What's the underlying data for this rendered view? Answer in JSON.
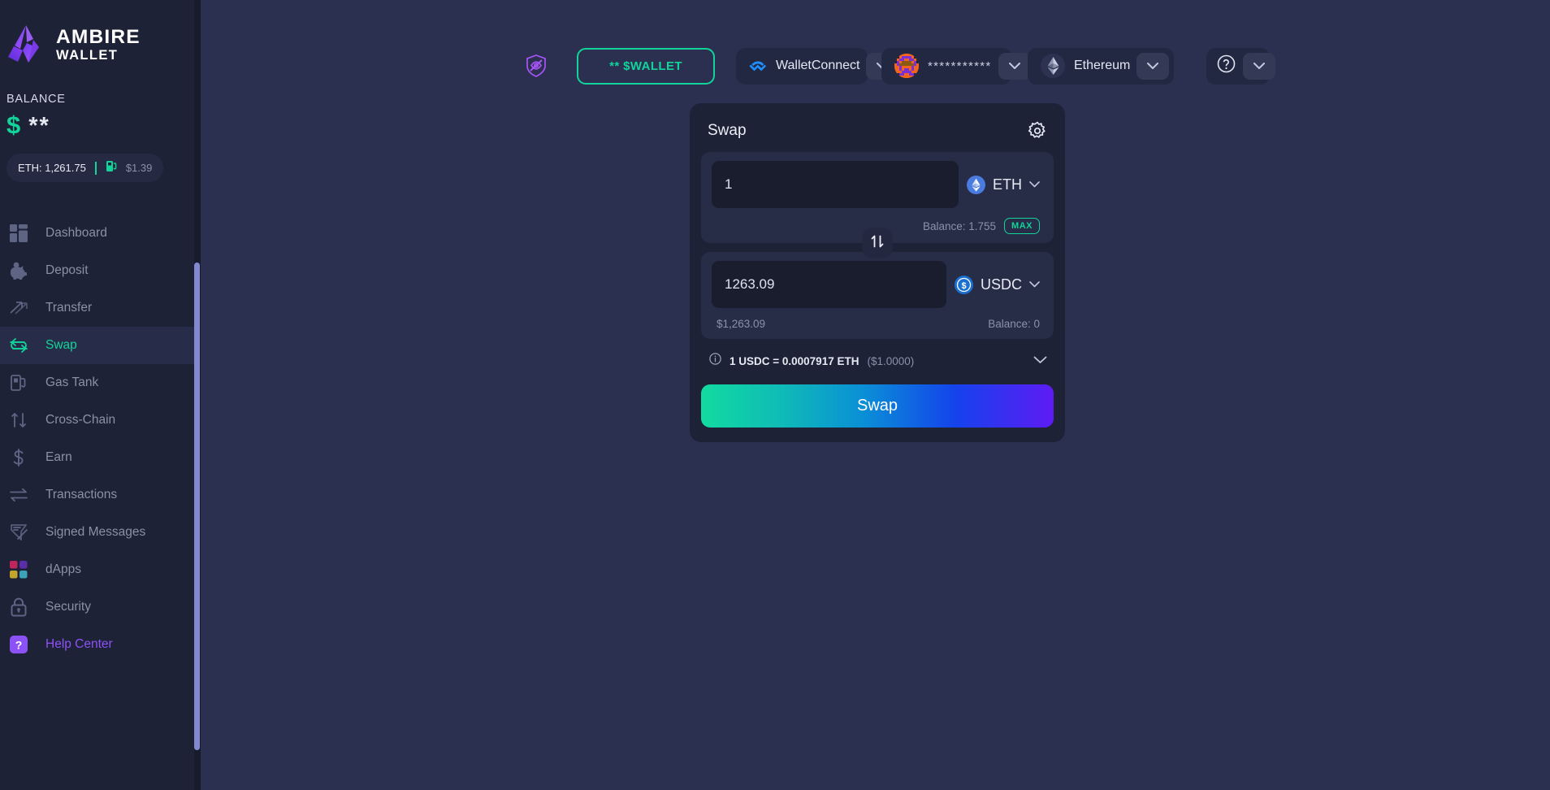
{
  "brand": {
    "name": "AMBIRE",
    "sub": "WALLET",
    "logo_icon": "ambire-logo-icon"
  },
  "sidebar": {
    "balance_label": "BALANCE",
    "balance_currency": "$",
    "balance_value": "**",
    "gas_chip": {
      "eth_label": "ETH: 1,261.75",
      "gas_icon": "gas-pump-icon",
      "gas_price": "$1.39"
    },
    "items": [
      {
        "label": "Dashboard",
        "icon": "dashboard-grid-icon",
        "active": false
      },
      {
        "label": "Deposit",
        "icon": "piggy-bank-icon",
        "active": false
      },
      {
        "label": "Transfer",
        "icon": "transfer-arrows-icon",
        "active": false
      },
      {
        "label": "Swap",
        "icon": "swap-arrows-icon",
        "active": true
      },
      {
        "label": "Gas Tank",
        "icon": "gas-tank-icon",
        "active": false
      },
      {
        "label": "Cross-Chain",
        "icon": "cross-chain-icon",
        "active": false
      },
      {
        "label": "Earn",
        "icon": "dollar-sign-icon",
        "active": false
      },
      {
        "label": "Transactions",
        "icon": "transactions-icon",
        "active": false
      },
      {
        "label": "Signed Messages",
        "icon": "signed-messages-icon",
        "active": false
      },
      {
        "label": "dApps",
        "icon": "dapps-squares-icon",
        "active": false
      },
      {
        "label": "Security",
        "icon": "lock-icon",
        "active": false
      },
      {
        "label": "Help Center",
        "icon": "help-center-icon",
        "active": false
      }
    ]
  },
  "topbar": {
    "hide_balance_icon": "eye-off-shield-icon",
    "wallet_pill_label": "** $WALLET",
    "walletconnect": {
      "label": "WalletConnect",
      "icon": "walletconnect-icon",
      "caret": "chevron-down-icon"
    },
    "account": {
      "address_masked": "***********",
      "avatar": "account-blockie-avatar",
      "caret": "chevron-down-icon"
    },
    "network": {
      "label": "Ethereum",
      "icon": "ethereum-icon",
      "caret": "chevron-down-icon"
    },
    "help": {
      "icon": "question-circle-icon",
      "caret": "chevron-down-icon"
    }
  },
  "swap": {
    "title": "Swap",
    "settings_icon": "gear-icon",
    "from": {
      "amount": "1",
      "placeholder": "0",
      "token": "ETH",
      "token_icon": "eth-token-icon",
      "balance_label": "Balance: 1.755",
      "max_label": "MAX"
    },
    "flip_icon": "swap-vertical-icon",
    "to": {
      "amount": "1263.09",
      "placeholder": "0",
      "token": "USDC",
      "token_icon": "usdc-token-icon",
      "usd_value": "$1,263.09",
      "balance_label": "Balance: 0"
    },
    "rate": {
      "info_icon": "info-circle-icon",
      "text": "1 USDC = 0.0007917 ETH",
      "usd": "($1.0000)",
      "caret": "chevron-down-icon"
    },
    "submit_label": "Swap"
  },
  "colors": {
    "accent_green": "#12d39a",
    "purple": "#8d52f5",
    "page_bg": "#2b3050",
    "sidebar_bg": "#1e2236",
    "card_bg": "#1e2236",
    "panel_bg": "#272c47",
    "input_bg": "#191d2e"
  }
}
